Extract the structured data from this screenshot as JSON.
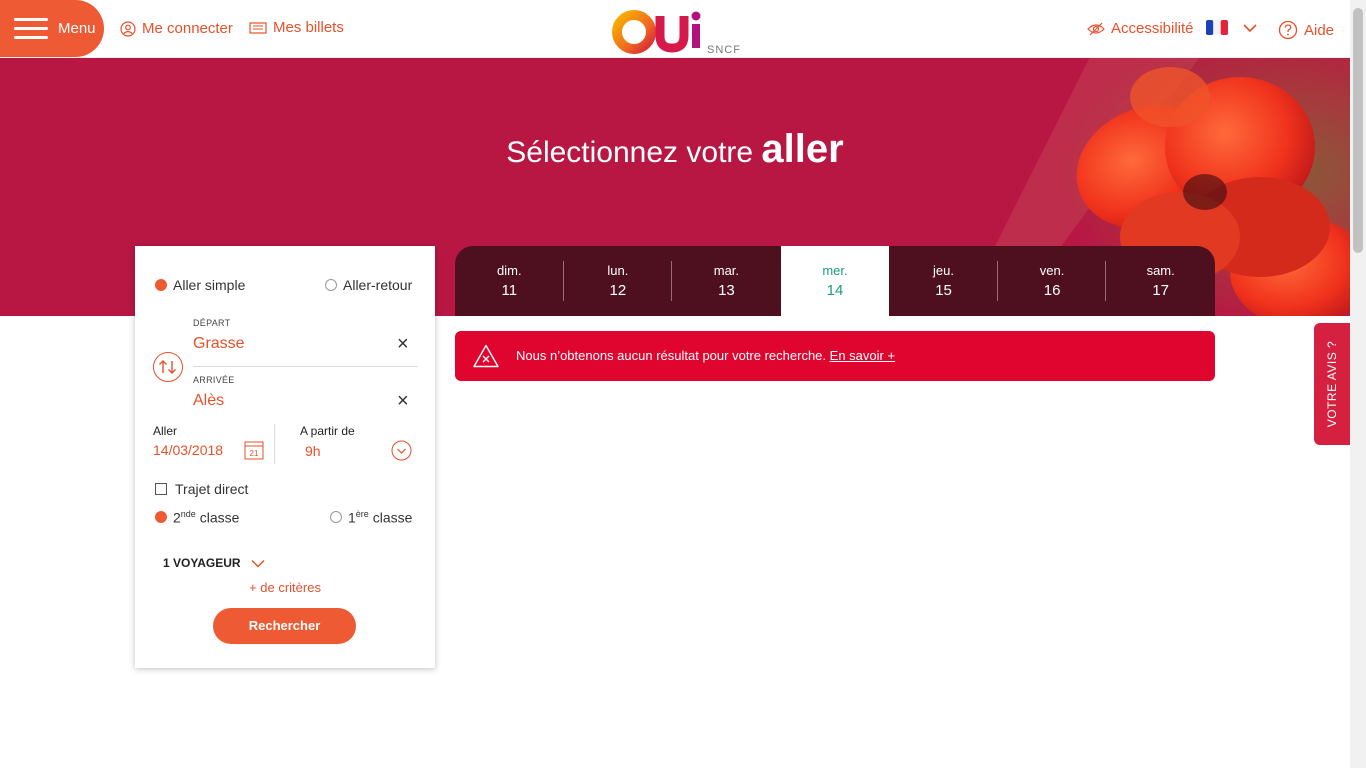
{
  "header": {
    "menu_label": "Menu",
    "login_label": "Me connecter",
    "tickets_label": "Mes billets",
    "logo_main": "OUi",
    "logo_sub": "SNCF",
    "accessibility_label": "Accessibilité",
    "language_icon": "flag-fr-icon",
    "help_label": "Aide"
  },
  "hero": {
    "title_prefix": "Sélectionnez votre",
    "title_emphasis": "aller"
  },
  "search": {
    "trip_type": {
      "one_way_label": "Aller simple",
      "return_label": "Aller-retour",
      "selected": "Aller simple"
    },
    "departure_label": "DÉPART",
    "departure_value": "Grasse",
    "arrival_label": "ARRIVÉE",
    "arrival_value": "Alès",
    "date_label": "Aller",
    "date_value": "14/03/2018",
    "calendar_icon_text": "21",
    "time_label": "A partir de",
    "time_value": "9h",
    "direct_label": "Trajet direct",
    "direct_checked": false,
    "class_second_num": "2",
    "class_second_sup": "nde",
    "class_second_word": " classe",
    "class_first_num": "1",
    "class_first_sup": "ère",
    "class_first_word": " classe",
    "class_selected": "2nde",
    "travellers_label": "1 VOYAGEUR",
    "more_criteria_label": "+ de critères",
    "submit_label": "Rechercher"
  },
  "date_tabs": [
    {
      "day": "dim.",
      "num": "11",
      "active": false
    },
    {
      "day": "lun.",
      "num": "12",
      "active": false
    },
    {
      "day": "mar.",
      "num": "13",
      "active": false
    },
    {
      "day": "mer.",
      "num": "14",
      "active": true
    },
    {
      "day": "jeu.",
      "num": "15",
      "active": false
    },
    {
      "day": "ven.",
      "num": "16",
      "active": false
    },
    {
      "day": "sam.",
      "num": "17",
      "active": false
    }
  ],
  "alert": {
    "message": "Nous n’obtenons aucun résultat pour votre recherche.",
    "link_label": "En savoir +"
  },
  "feedback_label": "VOTRE AVIS ?",
  "colors": {
    "brand_orange": "#ee5a33",
    "hero_crimson": "#b81744",
    "tabs_dark": "#4e0f1e",
    "active_date_green": "#1c9b7e",
    "alert_red": "#e0052e"
  }
}
